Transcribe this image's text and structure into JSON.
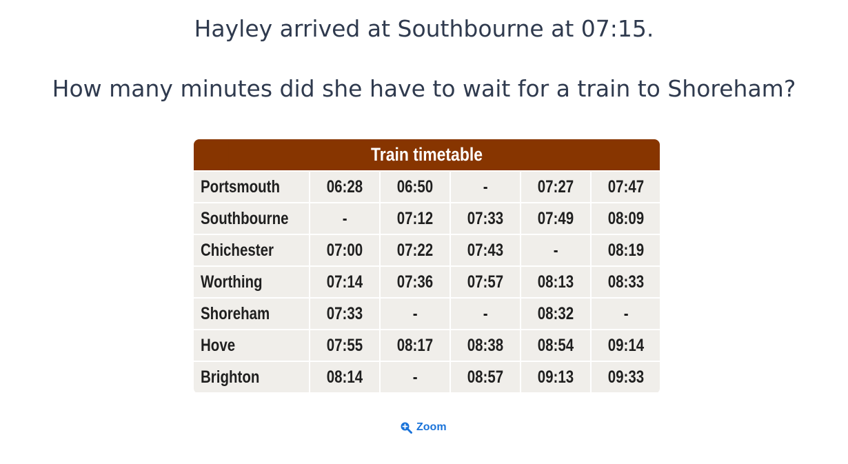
{
  "question": {
    "line1": "Hayley arrived at Southbourne at 07:15.",
    "line2": "How many minutes did she have to wait for a train to Shoreham?"
  },
  "timetable": {
    "title": "Train timetable",
    "rows": [
      {
        "station": "Portsmouth",
        "times": [
          "06:28",
          "06:50",
          "-",
          "07:27",
          "07:47"
        ]
      },
      {
        "station": "Southbourne",
        "times": [
          "-",
          "07:12",
          "07:33",
          "07:49",
          "08:09"
        ]
      },
      {
        "station": "Chichester",
        "times": [
          "07:00",
          "07:22",
          "07:43",
          "-",
          "08:19"
        ]
      },
      {
        "station": "Worthing",
        "times": [
          "07:14",
          "07:36",
          "07:57",
          "08:13",
          "08:33"
        ]
      },
      {
        "station": "Shoreham",
        "times": [
          "07:33",
          "-",
          "-",
          "08:32",
          "-"
        ]
      },
      {
        "station": "Hove",
        "times": [
          "07:55",
          "08:17",
          "08:38",
          "08:54",
          "09:14"
        ]
      },
      {
        "station": "Brighton",
        "times": [
          "08:14",
          "-",
          "08:57",
          "09:13",
          "09:33"
        ]
      }
    ]
  },
  "zoom": {
    "label": "Zoom",
    "icon": "zoom-in-icon"
  },
  "colors": {
    "header_bg": "#873500",
    "cell_bg": "#f0eeea",
    "link": "#1a73d9",
    "text": "#2f3a4e"
  }
}
